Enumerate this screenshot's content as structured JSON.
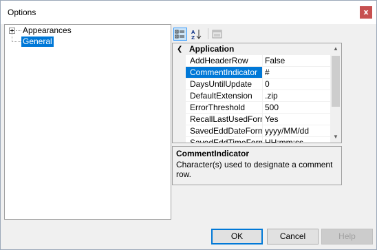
{
  "window": {
    "title": "Options",
    "close_label": "x"
  },
  "tree": {
    "items": [
      {
        "label": "Appearances",
        "expandable": true,
        "selected": false
      },
      {
        "label": "General",
        "expandable": false,
        "selected": true
      }
    ]
  },
  "property_grid": {
    "toolbar": [
      {
        "icon": "categorized-icon",
        "active": true
      },
      {
        "icon": "alphabetical-sort-icon",
        "active": false
      },
      {
        "icon": "property-pages-icon",
        "active": false,
        "disabled": true
      }
    ],
    "category": "Application",
    "rows": [
      {
        "name": "AddHeaderRow",
        "value": "False"
      },
      {
        "name": "CommentIndicator",
        "value": "#",
        "selected": true
      },
      {
        "name": "DaysUntilUpdate",
        "value": "0"
      },
      {
        "name": "DefaultExtension",
        "value": ".zip"
      },
      {
        "name": "ErrorThreshold",
        "value": "500"
      },
      {
        "name": "RecallLastUsedForm",
        "value": "Yes"
      },
      {
        "name": "SavedEddDateFormat",
        "value": "yyyy/MM/dd"
      },
      {
        "name": "SavedEddTimeFormat",
        "value": "HH:mm:ss"
      }
    ]
  },
  "help": {
    "title": "CommentIndicator",
    "description": "Character(s) used to designate a comment row."
  },
  "buttons": {
    "ok": "OK",
    "cancel": "Cancel",
    "help": "Help"
  },
  "colors": {
    "selection": "#0078d7",
    "close_button": "#c75050"
  }
}
